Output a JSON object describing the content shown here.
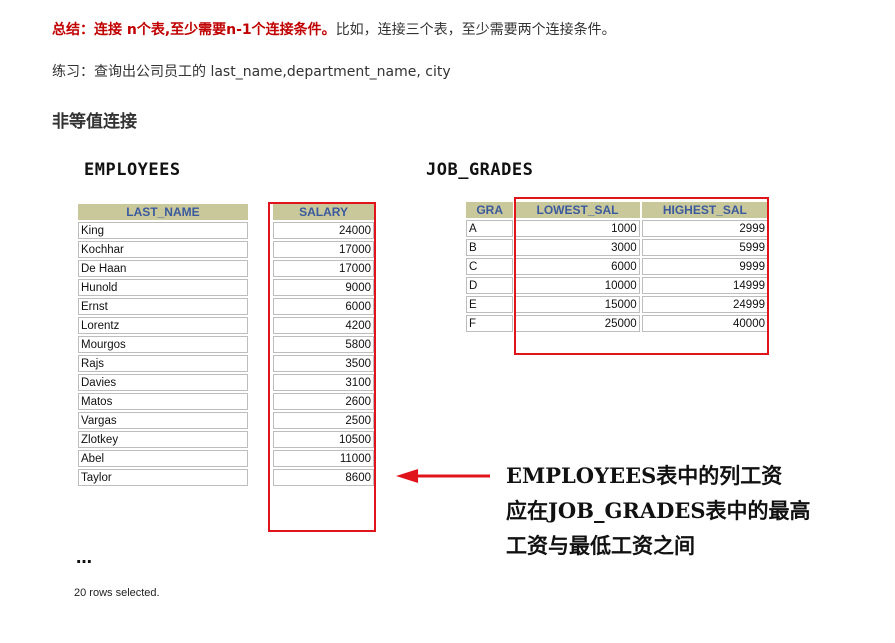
{
  "summary": {
    "highlight": "总结：连接 n个表,至少需要n-1个连接条件。",
    "rest": "比如，连接三个表，至少需要两个连接条件。"
  },
  "practice": "练习：查询出公司员工的 last_name,department_name, city",
  "heading": "非等值连接",
  "employees": {
    "title": "EMPLOYEES",
    "headers": [
      "LAST_NAME",
      "SALARY"
    ],
    "rows": [
      [
        "King",
        "24000"
      ],
      [
        "Kochhar",
        "17000"
      ],
      [
        "De Haan",
        "17000"
      ],
      [
        "Hunold",
        "9000"
      ],
      [
        "Ernst",
        "6000"
      ],
      [
        "Lorentz",
        "4200"
      ],
      [
        "Mourgos",
        "5800"
      ],
      [
        "Rajs",
        "3500"
      ],
      [
        "Davies",
        "3100"
      ],
      [
        "Matos",
        "2600"
      ],
      [
        "Vargas",
        "2500"
      ],
      [
        "Zlotkey",
        "10500"
      ],
      [
        "Abel",
        "11000"
      ],
      [
        "Taylor",
        "8600"
      ]
    ],
    "ellipsis": "…",
    "rows_selected": "20 rows selected."
  },
  "job_grades": {
    "title": "JOB_GRADES",
    "headers": [
      "GRA",
      "LOWEST_SAL",
      "HIGHEST_SAL"
    ],
    "rows": [
      [
        "A",
        "1000",
        "2999"
      ],
      [
        "B",
        "3000",
        "5999"
      ],
      [
        "C",
        "6000",
        "9999"
      ],
      [
        "D",
        "10000",
        "14999"
      ],
      [
        "E",
        "15000",
        "24999"
      ],
      [
        "F",
        "25000",
        "40000"
      ]
    ]
  },
  "callout": {
    "line1": "EMPLOYEES表中的列工资",
    "line2": "应在JOB_GRADES表中的最高",
    "line3": "工资与最低工资之间"
  },
  "colors": {
    "highlight": "#c00000",
    "redbox": "#e0141b",
    "header_bg": "#c9c89a",
    "header_text": "#3b5a9e"
  }
}
